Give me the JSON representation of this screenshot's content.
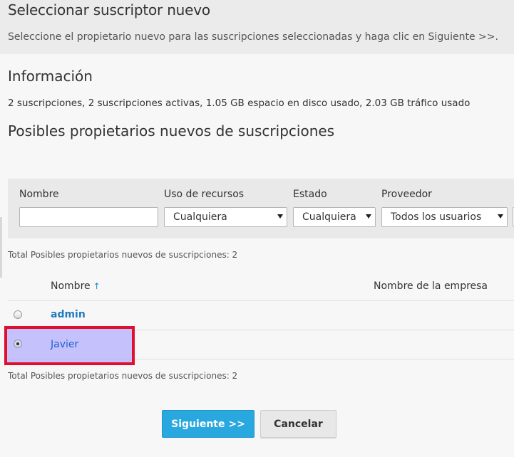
{
  "header": {
    "title": "Seleccionar suscriptor nuevo",
    "description": "Seleccione el propietario nuevo para las suscripciones seleccionadas y haga clic en Siguiente >>."
  },
  "info": {
    "heading": "Información",
    "text": "2 suscripciones, 2 suscripciones activas, 1.05 GB espacio en disco usado, 2.03 GB tráfico usado"
  },
  "owners": {
    "heading": "Posibles propietarios nuevos de suscripciones",
    "total_top": "Total Posibles propietarios nuevos de suscripciones: 2",
    "total_bottom": "Total Posibles propietarios nuevos de suscripciones: 2"
  },
  "filters": {
    "name_label": "Nombre",
    "name_value": "",
    "usage_label": "Uso de recursos",
    "usage_value": "Cualquiera",
    "status_label": "Estado",
    "status_value": "Cualquiera",
    "provider_label": "Proveedor",
    "provider_value": "Todos los usuarios"
  },
  "table": {
    "columns": {
      "name": "Nombre",
      "sort_icon": "↑",
      "company": "Nombre de la empresa"
    },
    "rows": [
      {
        "name": "admin",
        "selected": false
      },
      {
        "name": "Javier",
        "selected": true
      }
    ]
  },
  "buttons": {
    "next": "Siguiente >>",
    "cancel": "Cancelar"
  },
  "colors": {
    "link": "#1e7bbf",
    "primary_button": "#29a7df",
    "highlight_border": "#e0102c"
  }
}
